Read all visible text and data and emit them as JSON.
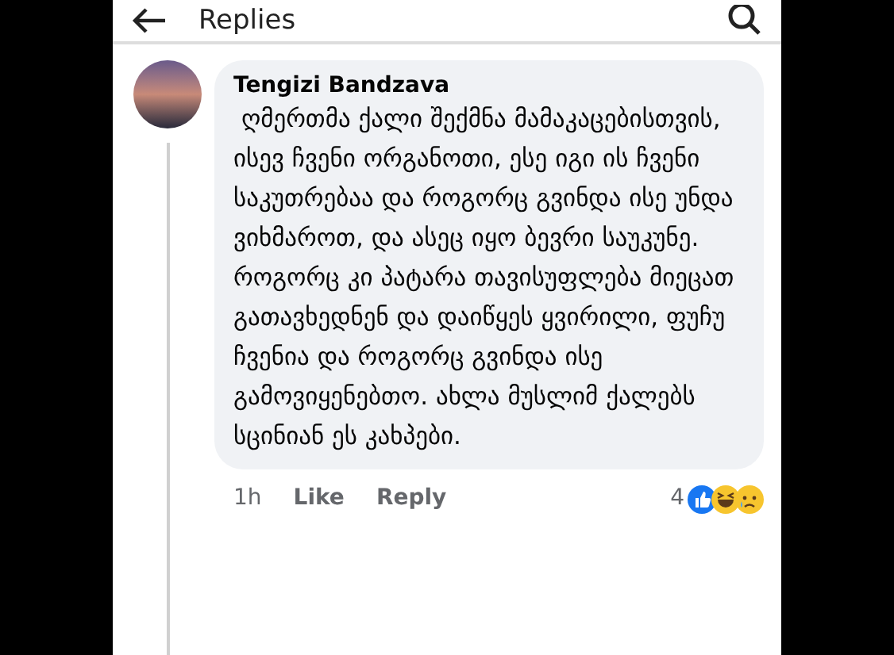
{
  "header": {
    "title": "Replies"
  },
  "comment": {
    "author": "Tengizi Bandzava",
    "text": " ღმერთმა ქალი შექმნა მამაკაცებისთვის,  ისევ ჩვენი ორგანოთი, ესე იგი ის ჩვენი საკუთრებაა და როგორც გვინდა ისე უნდა ვიხმაროთ, და ასეც იყო ბევრი საუკუნე. როგორც კი პატარა თავისუფლება მიეცათ გათავხედნენ და დაიწყეს ყვირილი, ფუჩუ ჩვენია და როგორც გვინდა ისე გამოვიყენებთო. ახლა მუსლიმ ქალებს სცინიან ეს კახპები.",
    "time": "1h",
    "like": "Like",
    "reply": "Reply",
    "reaction_count": "4"
  }
}
